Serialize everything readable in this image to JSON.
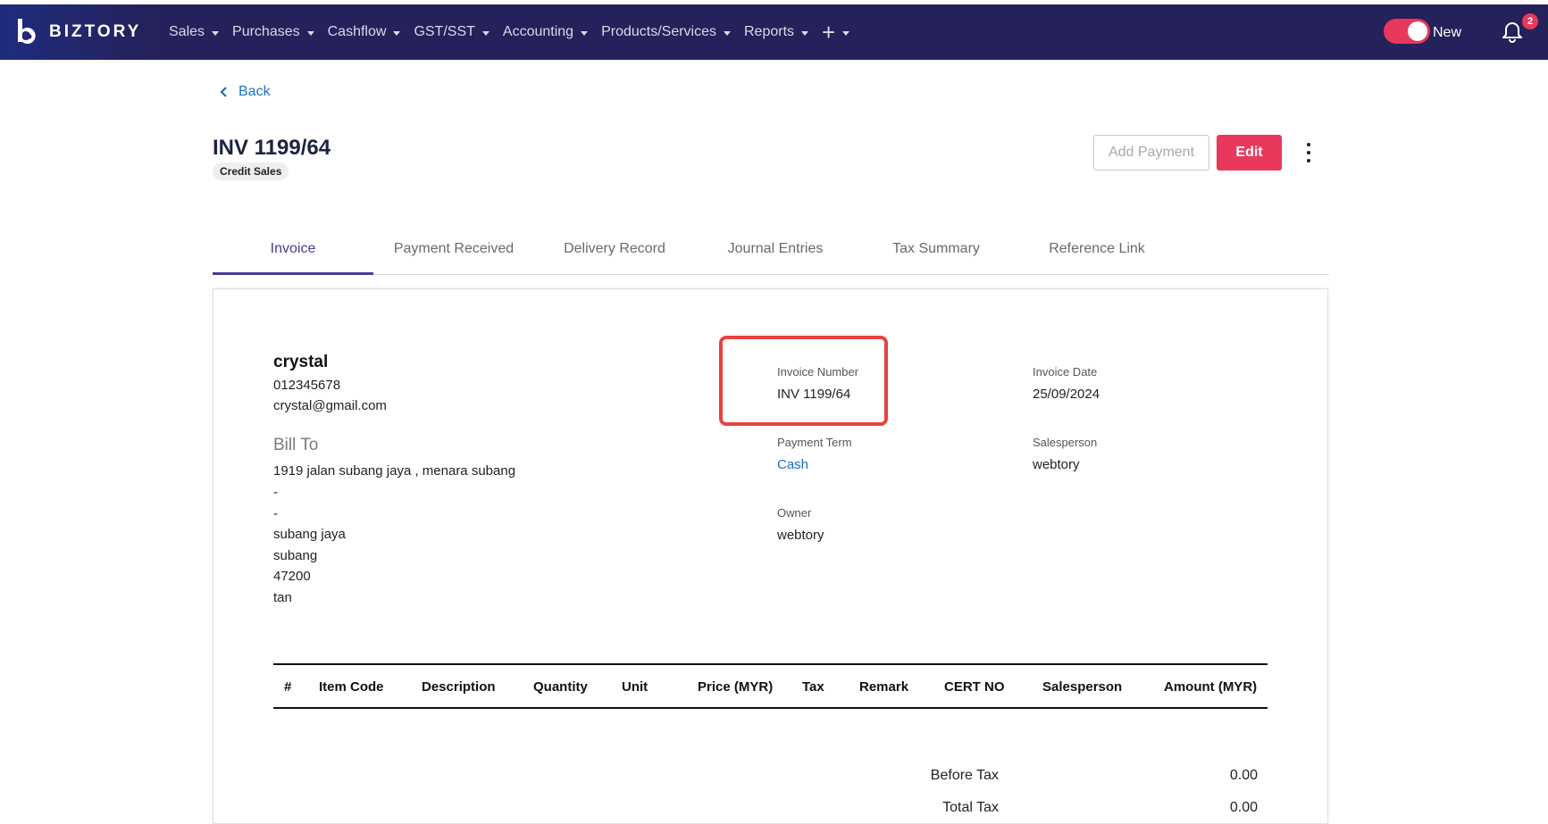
{
  "brand": {
    "name": "BIZTORY"
  },
  "nav": {
    "items": [
      "Sales",
      "Purchases",
      "Cashflow",
      "GST/SST",
      "Accounting",
      "Products/Services",
      "Reports"
    ],
    "plus_symbol": "+"
  },
  "toggle": {
    "label": "New",
    "on": true
  },
  "notifications": {
    "count": "2"
  },
  "back_label": "Back",
  "document": {
    "number": "INV 1199/64",
    "type_badge": "Credit Sales"
  },
  "actions": {
    "add_payment": "Add Payment",
    "edit": "Edit"
  },
  "tabs": [
    "Invoice",
    "Payment Received",
    "Delivery Record",
    "Journal Entries",
    "Tax Summary",
    "Reference Link"
  ],
  "active_tab": "Invoice",
  "customer": {
    "name": "crystal",
    "phone": "012345678",
    "email": "crystal@gmail.com",
    "bill_to_heading": "Bill To",
    "address_lines": [
      "1919 jalan subang jaya , menara subang",
      "-",
      "-",
      "subang jaya",
      "subang",
      "47200",
      "tan"
    ]
  },
  "info": {
    "invoice_number_label": "Invoice Number",
    "invoice_number": "INV 1199/64",
    "invoice_date_label": "Invoice Date",
    "invoice_date": "25/09/2024",
    "payment_term_label": "Payment Term",
    "payment_term": "Cash",
    "salesperson_label": "Salesperson",
    "salesperson": "webtory",
    "owner_label": "Owner",
    "owner": "webtory"
  },
  "table": {
    "headers": [
      "#",
      "Item Code",
      "Description",
      "Quantity",
      "Unit",
      "Price (MYR)",
      "Tax",
      "Remark",
      "CERT NO",
      "Salesperson",
      "Amount (MYR)"
    ],
    "rows": []
  },
  "summary": {
    "before_tax_label": "Before Tax",
    "before_tax": "0.00",
    "total_tax_label": "Total Tax",
    "total_tax": "0.00"
  },
  "colors": {
    "navbar": "#25215a",
    "accent": "#e8385c",
    "tab_active": "#4a3b94",
    "link": "#1a6fc0",
    "highlight": "#e6433f"
  }
}
